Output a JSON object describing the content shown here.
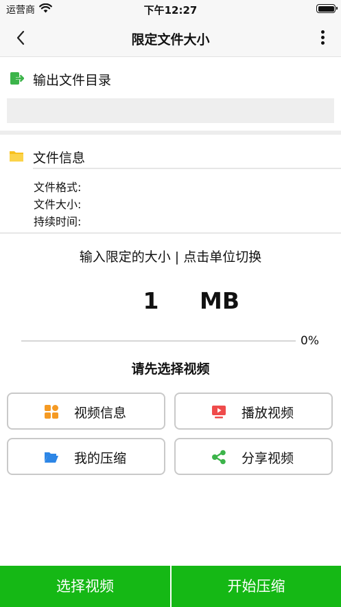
{
  "status_bar": {
    "carrier": "运营商",
    "time": "下午12:27"
  },
  "nav": {
    "title": "限定文件大小"
  },
  "output_section": {
    "title": "输出文件目录",
    "path_value": ""
  },
  "file_info": {
    "title": "文件信息",
    "format_label": "文件格式:",
    "size_label": "文件大小:",
    "duration_label": "持续时间:"
  },
  "limit": {
    "hint": "输入限定的大小 | 点击单位切换",
    "value": "1",
    "unit": "MB"
  },
  "progress": {
    "value": 0,
    "text": "0%"
  },
  "prompt": "请先选择视频",
  "actions": {
    "video_info": "视频信息",
    "play_video": "播放视频",
    "my_compress": "我的压缩",
    "share_video": "分享视频"
  },
  "bottom": {
    "select_video": "选择视频",
    "start_compress": "开始压缩"
  },
  "colors": {
    "accent_green": "#15b815",
    "icon_orange": "#f59a23",
    "icon_red": "#ef4b4b",
    "icon_blue": "#2d86e6",
    "icon_green": "#3cb44a",
    "folder_yellow": "#f7c01e"
  }
}
